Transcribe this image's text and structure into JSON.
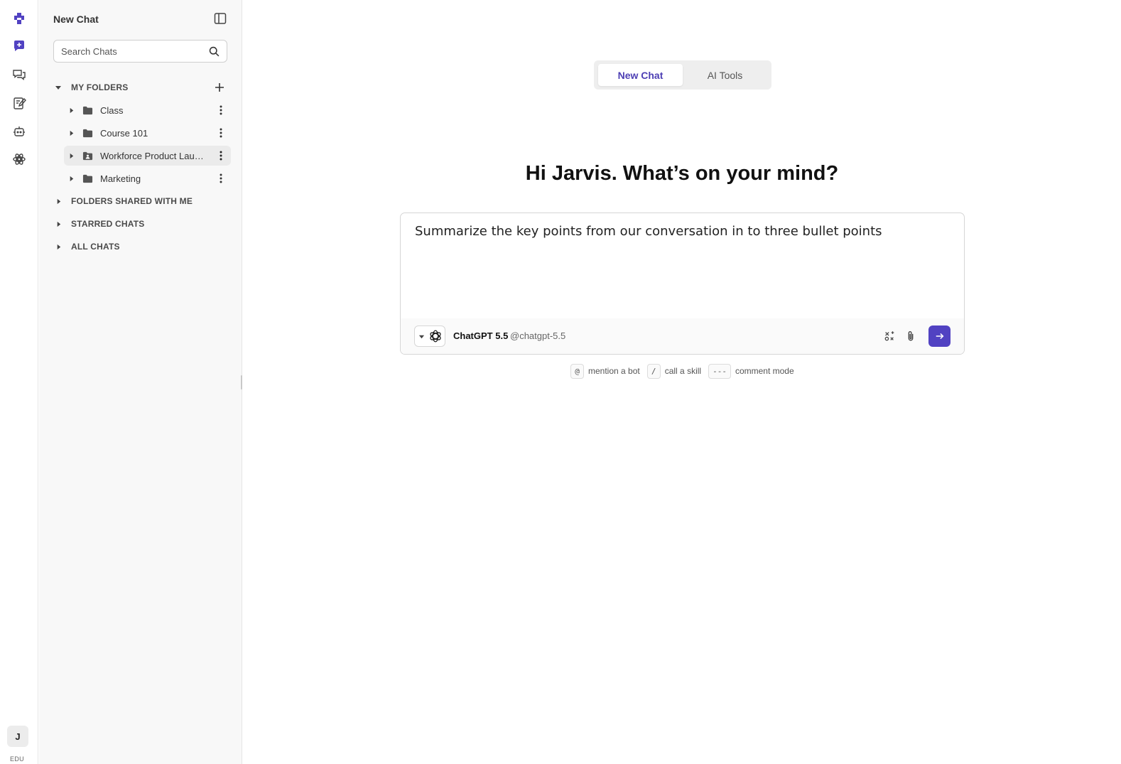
{
  "rail": {
    "icons": [
      "brand-logo-icon",
      "new-chat-icon",
      "chats-icon",
      "notes-icon",
      "bots-icon",
      "tools-icon"
    ],
    "accent": "#5142c2",
    "avatar_initial": "J",
    "plan_label": "EDU"
  },
  "sidebar": {
    "title": "New Chat",
    "search_placeholder": "Search Chats",
    "sections": {
      "my_folders": "MY FOLDERS",
      "shared": "FOLDERS SHARED WITH ME",
      "starred": "STARRED CHATS",
      "all": "ALL CHATS"
    },
    "folders": [
      {
        "name": "Class",
        "icon": "folder-icon",
        "active": false
      },
      {
        "name": "Course 101",
        "icon": "folder-icon",
        "active": false
      },
      {
        "name": "Workforce Product Launch",
        "icon": "shared-folder-icon",
        "active": true
      },
      {
        "name": "Marketing",
        "icon": "folder-icon",
        "active": false
      }
    ]
  },
  "main": {
    "tabs": [
      {
        "label": "New Chat",
        "selected": true
      },
      {
        "label": "AI Tools",
        "selected": false
      }
    ],
    "greeting": "Hi Jarvis. What’s on your mind?",
    "composer": {
      "value": "Summarize the key points from our conversation in to three bullet points",
      "bot_name": "ChatGPT 5.5",
      "bot_handle": "@chatgpt-5.5",
      "icons": [
        "tools-off-icon",
        "paperclip-icon",
        "send-arrow-icon"
      ]
    },
    "hints": [
      {
        "key": "@",
        "text": "mention a bot"
      },
      {
        "key": "/",
        "text": "call a skill"
      },
      {
        "key": "---",
        "text": "comment mode"
      }
    ]
  }
}
